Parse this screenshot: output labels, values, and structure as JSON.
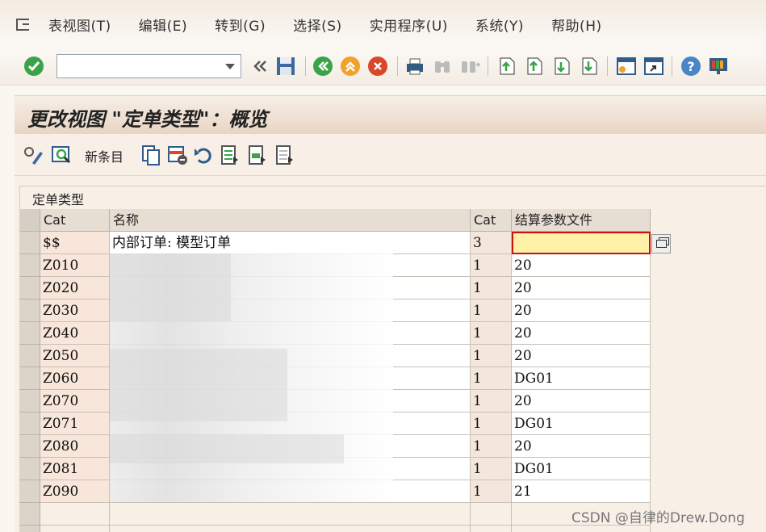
{
  "menu": {
    "items": [
      "表视图(T)",
      "编辑(E)",
      "转到(G)",
      "选择(S)",
      "实用程序(U)",
      "系统(Y)",
      "帮助(H)"
    ]
  },
  "toolbar": {
    "command_value": "",
    "icons": [
      "check-icon",
      "back-double-icon",
      "save-icon",
      "back-icon",
      "exit-icon",
      "cancel-icon",
      "print-icon",
      "find-icon",
      "find-next-icon",
      "first-page-icon",
      "prev-page-icon",
      "next-page-icon",
      "last-page-icon",
      "new-session-icon",
      "shortcut-icon",
      "help-icon",
      "layout-icon"
    ]
  },
  "title": "更改视图 \"定单类型\"：概览",
  "app_toolbar": {
    "new_entries": "新条目"
  },
  "group_title": "定单类型",
  "table": {
    "headers": [
      "Cat",
      "名称",
      "Cat",
      "结算参数文件"
    ],
    "rows": [
      {
        "cat": "$$",
        "name": "内部订单: 模型订单",
        "num": "3",
        "param": ""
      },
      {
        "cat": "Z010",
        "name": "",
        "num": "1",
        "param": "20"
      },
      {
        "cat": "Z020",
        "name": "",
        "num": "1",
        "param": "20"
      },
      {
        "cat": "Z030",
        "name": "",
        "num": "1",
        "param": "20"
      },
      {
        "cat": "Z040",
        "name": "",
        "num": "1",
        "param": "20"
      },
      {
        "cat": "Z050",
        "name": "",
        "num": "1",
        "param": "20"
      },
      {
        "cat": "Z060",
        "name": "",
        "num": "1",
        "param": "DG01"
      },
      {
        "cat": "Z070",
        "name": "",
        "num": "1",
        "param": "20"
      },
      {
        "cat": "Z071",
        "name": "",
        "num": "1",
        "param": "DG01"
      },
      {
        "cat": "Z080",
        "name": "",
        "num": "1",
        "param": "20"
      },
      {
        "cat": "Z081",
        "name": "",
        "num": "1",
        "param": "DG01"
      },
      {
        "cat": "Z090",
        "name": "",
        "num": "1",
        "param": "21"
      }
    ]
  },
  "watermark": "CSDN @自律的Drew.Dong",
  "colors": {
    "accent_green": "#3aa34a",
    "accent_orange": "#f0a22a",
    "accent_red": "#d9462b",
    "focus_yellow": "#fff1a8"
  }
}
